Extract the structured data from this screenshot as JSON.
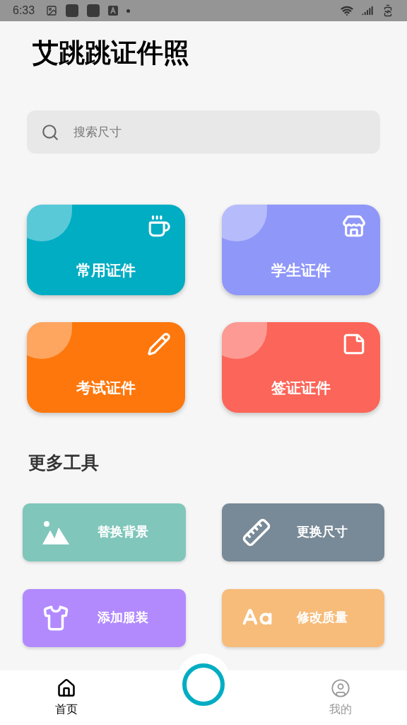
{
  "status_bar": {
    "time": "6:33"
  },
  "title": "艾跳跳证件照",
  "search": {
    "placeholder": "搜索尺寸"
  },
  "categories": [
    {
      "label": "常用证件",
      "color": "#00adc3"
    },
    {
      "label": "学生证件",
      "color": "#8f97f9"
    },
    {
      "label": "考试证件",
      "color": "#fd770c"
    },
    {
      "label": "签证证件",
      "color": "#fc6559"
    }
  ],
  "more_tools": {
    "title": "更多工具",
    "items": [
      {
        "label": "替换背景",
        "color": "#80c6bb"
      },
      {
        "label": "更换尺寸",
        "color": "#788997"
      },
      {
        "label": "添加服装",
        "color": "#b28afe"
      },
      {
        "label": "修改质量",
        "color": "#f7bc7a"
      }
    ]
  },
  "bottom_nav": [
    {
      "label": "首页",
      "selected": true
    },
    {
      "label": "我的",
      "selected": false
    }
  ]
}
